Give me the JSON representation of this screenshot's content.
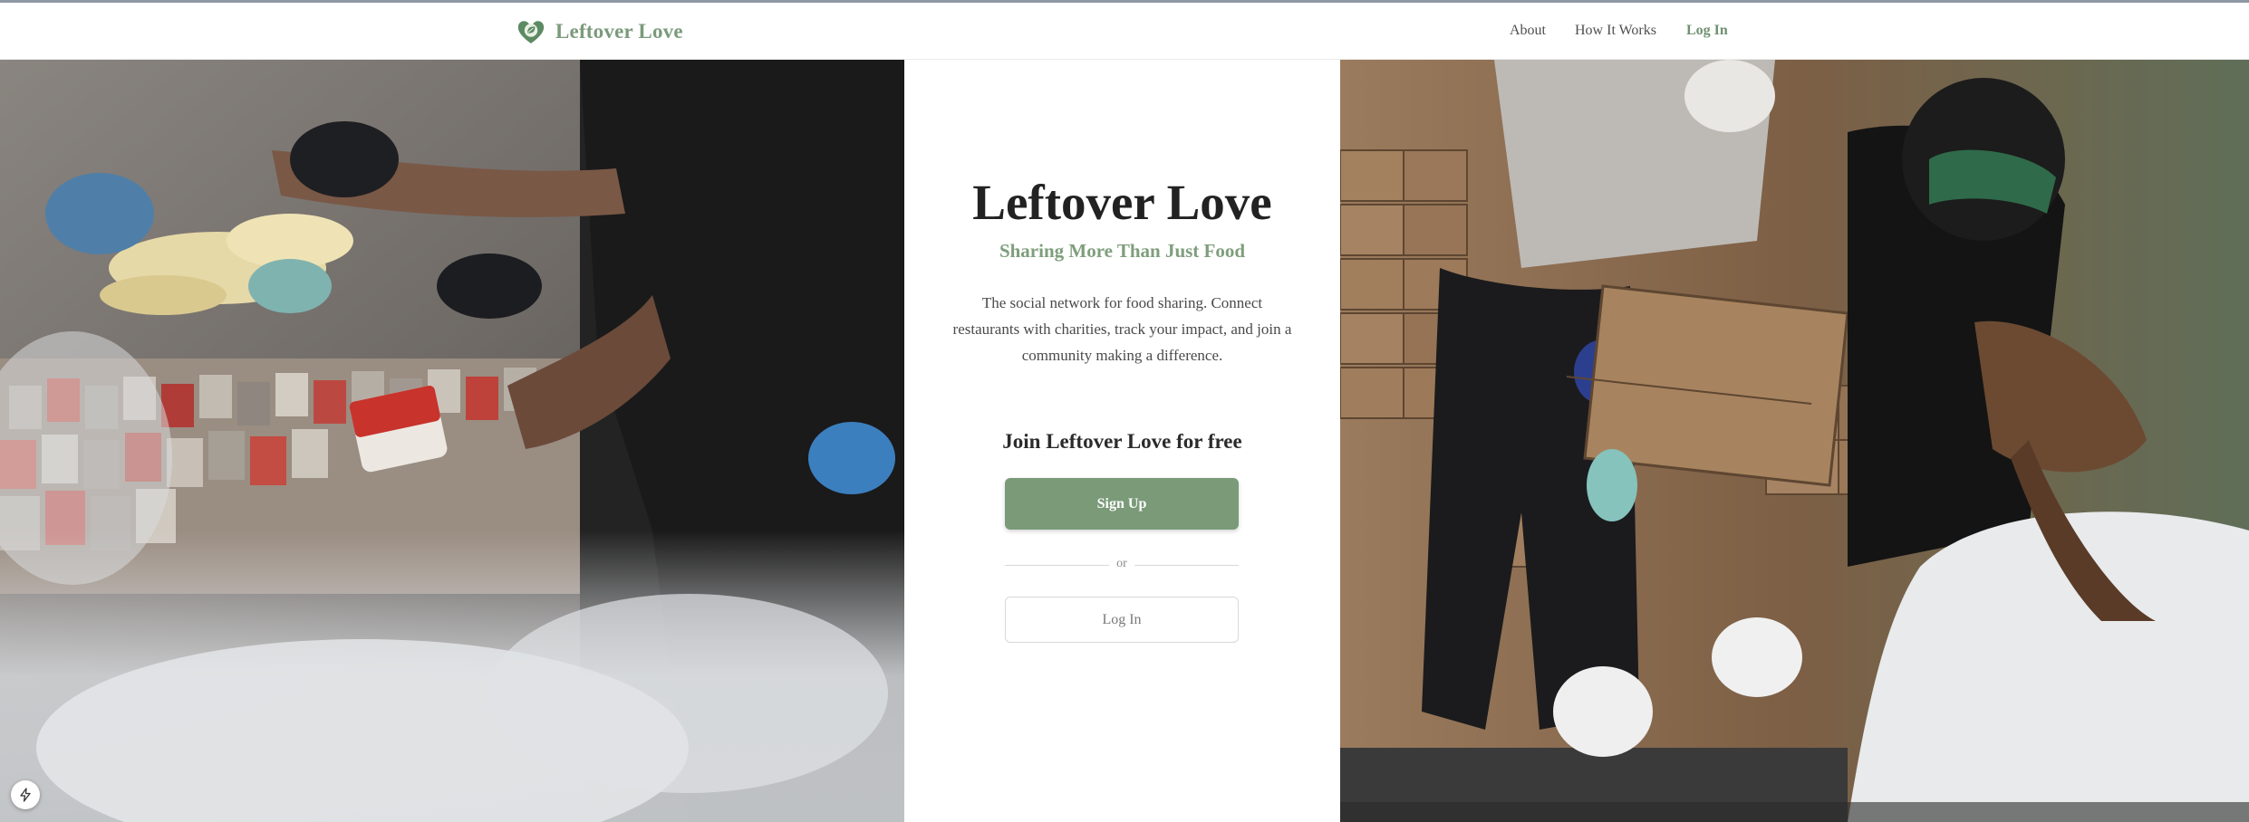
{
  "header": {
    "brand": "Leftover Love",
    "brand_icon": "heart-leaf-icon",
    "nav": [
      {
        "label": "About"
      },
      {
        "label": "How It Works"
      },
      {
        "label": "Log In"
      }
    ]
  },
  "hero": {
    "title": "Leftover Love",
    "tagline": "Sharing More Than Just Food",
    "description": "The social network for food sharing. Connect restaurants with charities, track your impact, and join a community making a difference."
  },
  "join": {
    "heading": "Join Leftover Love for free",
    "signup_label": "Sign Up",
    "divider_text": "or",
    "login_label": "Log In"
  },
  "widget": {
    "icon": "lightning-bolt-icon"
  },
  "colors": {
    "brand_green": "#7b9a7b",
    "button_green": "#7a9a78",
    "heading": "#222222"
  }
}
